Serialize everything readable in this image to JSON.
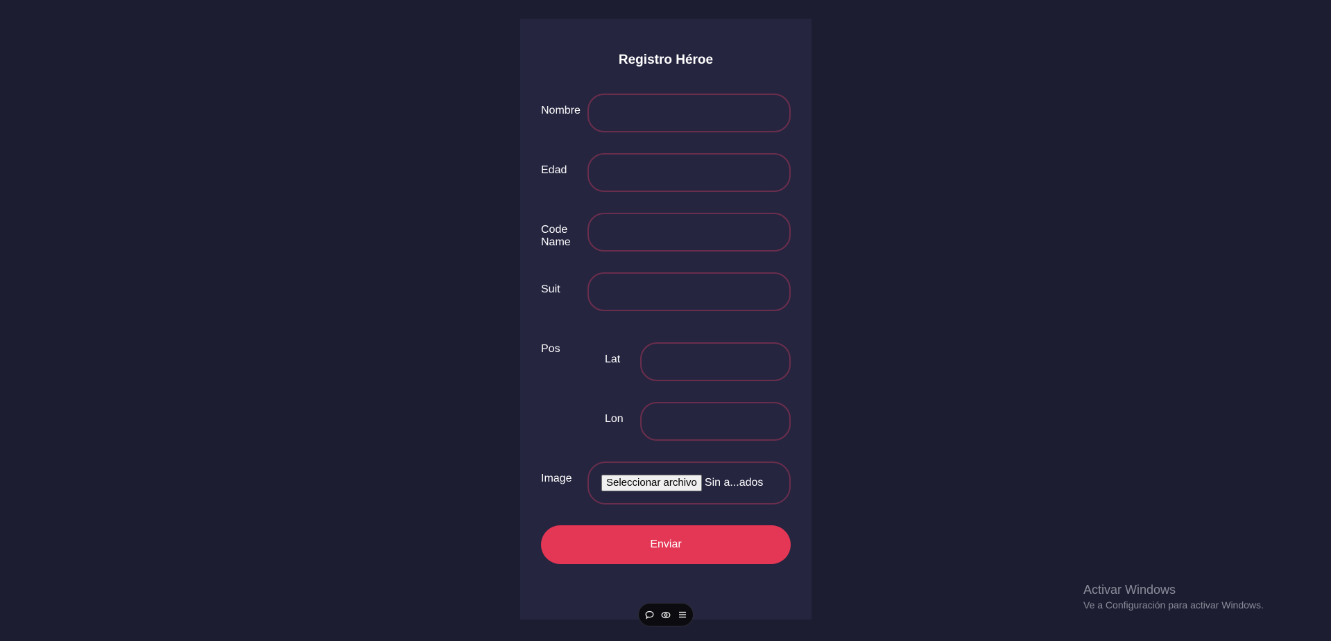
{
  "form": {
    "title": "Registro Héroe",
    "fields": {
      "nombre": {
        "label": "Nombre",
        "value": ""
      },
      "edad": {
        "label": "Edad",
        "value": ""
      },
      "code_name": {
        "label_line1": "Code",
        "label_line2": "Name",
        "value": ""
      },
      "suit": {
        "label": "Suit",
        "value": ""
      },
      "pos": {
        "label": "Pos",
        "lat": {
          "label": "Lat",
          "value": ""
        },
        "lon": {
          "label": "Lon",
          "value": ""
        }
      },
      "image": {
        "label": "Image",
        "button_label": "Seleccionar archivo",
        "status": "Sin a...ados"
      }
    },
    "submit_label": "Enviar"
  },
  "toolbar": {
    "icons": [
      "comment-icon",
      "eye-icon",
      "menu-icon"
    ]
  },
  "watermark": {
    "title": "Activar Windows",
    "subtitle": "Ve a Configuración para activar Windows."
  },
  "colors": {
    "background": "#1c1d31",
    "card": "#252540",
    "field_border": "#6a2e4c",
    "accent": "#e43655"
  }
}
